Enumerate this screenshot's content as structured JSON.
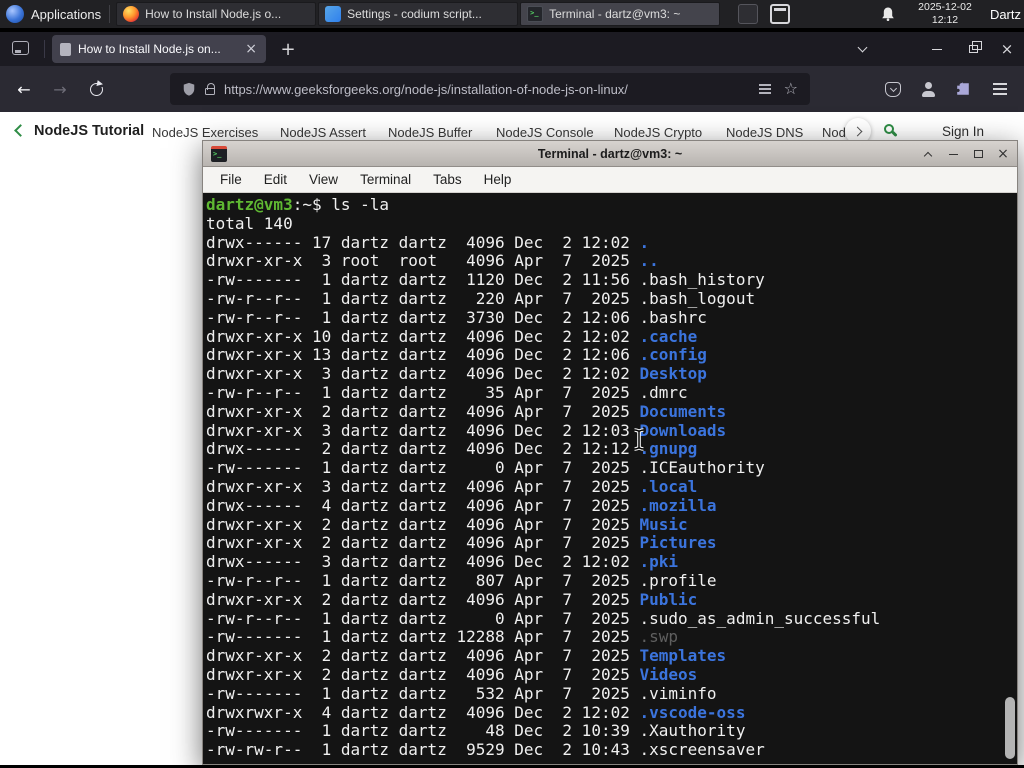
{
  "panel": {
    "applications_label": "Applications",
    "taskbar": [
      {
        "title": "How to Install Node.js o...",
        "icon": "firefox-icon"
      },
      {
        "title": "Settings - codium script...",
        "icon": "codium-icon"
      },
      {
        "title": "Terminal - dartz@vm3: ~",
        "icon": "terminal-icon"
      }
    ],
    "clock_date": "2025-12-02",
    "clock_time": "12:12",
    "user_label": "Dartz"
  },
  "browser": {
    "tab": {
      "title": "How to Install Node.js on..."
    },
    "url": "https://www.geeksforgeeks.org/node-js/installation-of-node-js-on-linux/"
  },
  "site_nav": {
    "brand": "NodeJS Tutorial",
    "links": [
      "NodeJS Exercises",
      "NodeJS Assert",
      "NodeJS Buffer",
      "NodeJS Console",
      "NodeJS Crypto",
      "NodeJS DNS",
      "Node"
    ],
    "sign_in": "Sign In"
  },
  "icons": {
    "back": "←",
    "forward": "→",
    "star": "☆",
    "new_tab": "+",
    "tab_close": "×",
    "window_close": "×",
    "titlebar_close": "×"
  },
  "terminal": {
    "window_title": "Terminal - dartz@vm3: ~",
    "menu": [
      "File",
      "Edit",
      "View",
      "Terminal",
      "Tabs",
      "Help"
    ],
    "prompt_user_host": "dartz@vm3",
    "prompt_rest": ":~$",
    "command": " ls -la",
    "total_line": "total 140",
    "colors": {
      "dir": "#3b74dd",
      "file": "#f0f0f0",
      "dim": "#5f5f5f",
      "prompt_green": "#5fb832",
      "background": "#141414"
    },
    "entries": [
      {
        "perm": "drwx------",
        "n": "17",
        "owner": "dartz",
        "group": "dartz",
        "size": "4096",
        "month": "Dec",
        "day": "2",
        "tail": "12:02",
        "name": ".",
        "type": "dir"
      },
      {
        "perm": "drwxr-xr-x",
        "n": "3",
        "owner": "root",
        "group": "root",
        "size": "4096",
        "month": "Apr",
        "day": "7",
        "tail": "2025",
        "name": "..",
        "type": "dir"
      },
      {
        "perm": "-rw-------",
        "n": "1",
        "owner": "dartz",
        "group": "dartz",
        "size": "1120",
        "month": "Dec",
        "day": "2",
        "tail": "11:56",
        "name": ".bash_history",
        "type": "file"
      },
      {
        "perm": "-rw-r--r--",
        "n": "1",
        "owner": "dartz",
        "group": "dartz",
        "size": "220",
        "month": "Apr",
        "day": "7",
        "tail": "2025",
        "name": ".bash_logout",
        "type": "file"
      },
      {
        "perm": "-rw-r--r--",
        "n": "1",
        "owner": "dartz",
        "group": "dartz",
        "size": "3730",
        "month": "Dec",
        "day": "2",
        "tail": "12:06",
        "name": ".bashrc",
        "type": "file"
      },
      {
        "perm": "drwxr-xr-x",
        "n": "10",
        "owner": "dartz",
        "group": "dartz",
        "size": "4096",
        "month": "Dec",
        "day": "2",
        "tail": "12:02",
        "name": ".cache",
        "type": "dir"
      },
      {
        "perm": "drwxr-xr-x",
        "n": "13",
        "owner": "dartz",
        "group": "dartz",
        "size": "4096",
        "month": "Dec",
        "day": "2",
        "tail": "12:06",
        "name": ".config",
        "type": "dir"
      },
      {
        "perm": "drwxr-xr-x",
        "n": "3",
        "owner": "dartz",
        "group": "dartz",
        "size": "4096",
        "month": "Dec",
        "day": "2",
        "tail": "12:02",
        "name": "Desktop",
        "type": "dir"
      },
      {
        "perm": "-rw-r--r--",
        "n": "1",
        "owner": "dartz",
        "group": "dartz",
        "size": "35",
        "month": "Apr",
        "day": "7",
        "tail": "2025",
        "name": ".dmrc",
        "type": "file"
      },
      {
        "perm": "drwxr-xr-x",
        "n": "2",
        "owner": "dartz",
        "group": "dartz",
        "size": "4096",
        "month": "Apr",
        "day": "7",
        "tail": "2025",
        "name": "Documents",
        "type": "dir"
      },
      {
        "perm": "drwxr-xr-x",
        "n": "3",
        "owner": "dartz",
        "group": "dartz",
        "size": "4096",
        "month": "Dec",
        "day": "2",
        "tail": "12:03",
        "name": "Downloads",
        "type": "dir"
      },
      {
        "perm": "drwx------",
        "n": "2",
        "owner": "dartz",
        "group": "dartz",
        "size": "4096",
        "month": "Dec",
        "day": "2",
        "tail": "12:12",
        "name": ".gnupg",
        "type": "dir"
      },
      {
        "perm": "-rw-------",
        "n": "1",
        "owner": "dartz",
        "group": "dartz",
        "size": "0",
        "month": "Apr",
        "day": "7",
        "tail": "2025",
        "name": ".ICEauthority",
        "type": "file"
      },
      {
        "perm": "drwxr-xr-x",
        "n": "3",
        "owner": "dartz",
        "group": "dartz",
        "size": "4096",
        "month": "Apr",
        "day": "7",
        "tail": "2025",
        "name": ".local",
        "type": "dir"
      },
      {
        "perm": "drwx------",
        "n": "4",
        "owner": "dartz",
        "group": "dartz",
        "size": "4096",
        "month": "Apr",
        "day": "7",
        "tail": "2025",
        "name": ".mozilla",
        "type": "dir"
      },
      {
        "perm": "drwxr-xr-x",
        "n": "2",
        "owner": "dartz",
        "group": "dartz",
        "size": "4096",
        "month": "Apr",
        "day": "7",
        "tail": "2025",
        "name": "Music",
        "type": "dir"
      },
      {
        "perm": "drwxr-xr-x",
        "n": "2",
        "owner": "dartz",
        "group": "dartz",
        "size": "4096",
        "month": "Apr",
        "day": "7",
        "tail": "2025",
        "name": "Pictures",
        "type": "dir"
      },
      {
        "perm": "drwx------",
        "n": "3",
        "owner": "dartz",
        "group": "dartz",
        "size": "4096",
        "month": "Dec",
        "day": "2",
        "tail": "12:02",
        "name": ".pki",
        "type": "dir"
      },
      {
        "perm": "-rw-r--r--",
        "n": "1",
        "owner": "dartz",
        "group": "dartz",
        "size": "807",
        "month": "Apr",
        "day": "7",
        "tail": "2025",
        "name": ".profile",
        "type": "file"
      },
      {
        "perm": "drwxr-xr-x",
        "n": "2",
        "owner": "dartz",
        "group": "dartz",
        "size": "4096",
        "month": "Apr",
        "day": "7",
        "tail": "2025",
        "name": "Public",
        "type": "dir"
      },
      {
        "perm": "-rw-r--r--",
        "n": "1",
        "owner": "dartz",
        "group": "dartz",
        "size": "0",
        "month": "Apr",
        "day": "7",
        "tail": "2025",
        "name": ".sudo_as_admin_successful",
        "type": "file"
      },
      {
        "perm": "-rw-------",
        "n": "1",
        "owner": "dartz",
        "group": "dartz",
        "size": "12288",
        "month": "Apr",
        "day": "7",
        "tail": "2025",
        "name": ".swp",
        "type": "dim"
      },
      {
        "perm": "drwxr-xr-x",
        "n": "2",
        "owner": "dartz",
        "group": "dartz",
        "size": "4096",
        "month": "Apr",
        "day": "7",
        "tail": "2025",
        "name": "Templates",
        "type": "dir"
      },
      {
        "perm": "drwxr-xr-x",
        "n": "2",
        "owner": "dartz",
        "group": "dartz",
        "size": "4096",
        "month": "Apr",
        "day": "7",
        "tail": "2025",
        "name": "Videos",
        "type": "dir"
      },
      {
        "perm": "-rw-------",
        "n": "1",
        "owner": "dartz",
        "group": "dartz",
        "size": "532",
        "month": "Apr",
        "day": "7",
        "tail": "2025",
        "name": ".viminfo",
        "type": "file"
      },
      {
        "perm": "drwxrwxr-x",
        "n": "4",
        "owner": "dartz",
        "group": "dartz",
        "size": "4096",
        "month": "Dec",
        "day": "2",
        "tail": "12:02",
        "name": ".vscode-oss",
        "type": "dir"
      },
      {
        "perm": "-rw-------",
        "n": "1",
        "owner": "dartz",
        "group": "dartz",
        "size": "48",
        "month": "Dec",
        "day": "2",
        "tail": "10:39",
        "name": ".Xauthority",
        "type": "file"
      },
      {
        "perm": "-rw-rw-r--",
        "n": "1",
        "owner": "dartz",
        "group": "dartz",
        "size": "9529",
        "month": "Dec",
        "day": "2",
        "tail": "10:43",
        "name": ".xscreensaver",
        "type": "file"
      }
    ]
  }
}
